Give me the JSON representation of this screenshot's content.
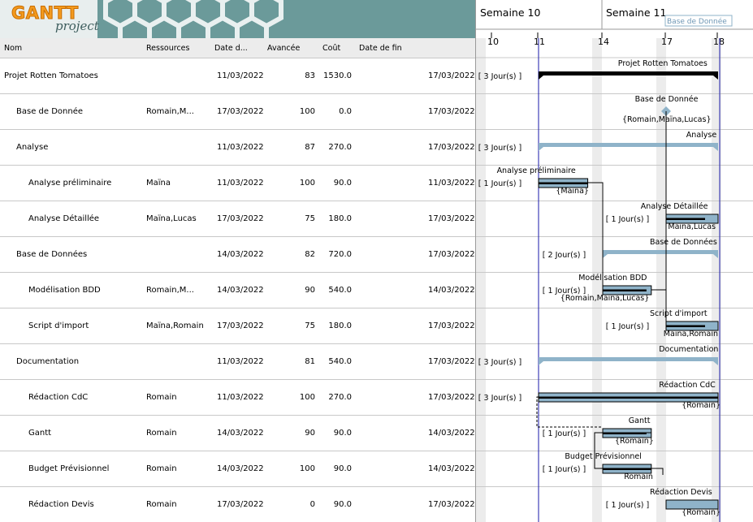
{
  "logo": {
    "gantt": "GANTT",
    "project": "project"
  },
  "columns": [
    "Nom",
    "Ressources",
    "Date d...",
    "Avancée",
    "Coût",
    "Date de fin"
  ],
  "tasks": [
    {
      "name": "Projet Rotten Tomatoes",
      "indent": 0,
      "resources": "",
      "start": "11/03/2022",
      "progress": "83",
      "cost": "1530.0",
      "end": "17/03/2022",
      "kind": "summary",
      "s": 11,
      "e": 18,
      "left_label": "[ 3 Jour(s) ]",
      "top_label": "Projet Rotten Tomatoes",
      "bottom_label": ""
    },
    {
      "name": "Base de Donnée",
      "indent": 1,
      "resources": "Romain,M...",
      "start": "17/03/2022",
      "progress": "100",
      "cost": "0.0",
      "end": "17/03/2022",
      "kind": "milestone",
      "s": 17,
      "e": 17,
      "left_label": "",
      "top_label": "Base de Donnée",
      "bottom_label": "{Romain,Maïna,Lucas}"
    },
    {
      "name": "Analyse",
      "indent": 1,
      "resources": "",
      "start": "11/03/2022",
      "progress": "87",
      "cost": "270.0",
      "end": "17/03/2022",
      "kind": "group",
      "s": 11,
      "e": 18,
      "left_label": "[ 3 Jour(s) ]",
      "top_label": "Analyse",
      "bottom_label": ""
    },
    {
      "name": "Analyse préliminaire",
      "indent": 2,
      "resources": "Maïna",
      "start": "11/03/2022",
      "progress": "100",
      "cost": "90.0",
      "end": "11/03/2022",
      "kind": "task",
      "s": 11,
      "e": 13.3,
      "pct": 1.0,
      "left_label": "[ 1 Jour(s) ]",
      "top_label": "Analyse préliminaire",
      "bottom_label": "{Maïna}"
    },
    {
      "name": "Analyse Détaillée",
      "indent": 2,
      "resources": "Maïna,Lucas",
      "start": "17/03/2022",
      "progress": "75",
      "cost": "180.0",
      "end": "17/03/2022",
      "kind": "task",
      "s": 17,
      "e": 18,
      "pct": 0.75,
      "left_label": "[ 1 Jour(s) ]",
      "top_label": "Analyse Détaillée",
      "bottom_label": "Maïna,Lucas"
    },
    {
      "name": "Base de Données",
      "indent": 1,
      "resources": "",
      "start": "14/03/2022",
      "progress": "82",
      "cost": "720.0",
      "end": "17/03/2022",
      "kind": "group",
      "s": 14,
      "e": 18,
      "left_label": "[ 2 Jour(s) ]",
      "top_label": "Base de Données",
      "bottom_label": ""
    },
    {
      "name": "Modélisation BDD",
      "indent": 2,
      "resources": "Romain,M...",
      "start": "14/03/2022",
      "progress": "90",
      "cost": "540.0",
      "end": "14/03/2022",
      "kind": "task",
      "s": 14,
      "e": 16.3,
      "pct": 0.9,
      "left_label": "[ 1 Jour(s) ]",
      "top_label": "Modélisation BDD",
      "bottom_label": "{Romain,Maïna,Lucas}"
    },
    {
      "name": "Script d'import",
      "indent": 2,
      "resources": "Maïna,Romain",
      "start": "17/03/2022",
      "progress": "75",
      "cost": "180.0",
      "end": "17/03/2022",
      "kind": "task",
      "s": 17,
      "e": 18,
      "pct": 0.75,
      "left_label": "[ 1 Jour(s) ]",
      "top_label": "Script d'import",
      "bottom_label": "Maïna,Romain"
    },
    {
      "name": "Documentation",
      "indent": 1,
      "resources": "",
      "start": "11/03/2022",
      "progress": "81",
      "cost": "540.0",
      "end": "17/03/2022",
      "kind": "group",
      "s": 11,
      "e": 18,
      "left_label": "[ 3 Jour(s) ]",
      "top_label": "Documentation",
      "bottom_label": ""
    },
    {
      "name": "Rédaction CdC",
      "indent": 2,
      "resources": "Romain",
      "start": "11/03/2022",
      "progress": "100",
      "cost": "270.0",
      "end": "17/03/2022",
      "kind": "task",
      "s": 11,
      "e": 18,
      "pct": 1.0,
      "left_label": "[ 3 Jour(s) ]",
      "top_label": "Rédaction CdC",
      "bottom_label": "{Romain}"
    },
    {
      "name": "Gantt",
      "indent": 2,
      "resources": "Romain",
      "start": "14/03/2022",
      "progress": "90",
      "cost": "90.0",
      "end": "14/03/2022",
      "kind": "task",
      "s": 14,
      "e": 16.3,
      "pct": 0.9,
      "left_label": "[ 1 Jour(s) ]",
      "top_label": "Gantt",
      "bottom_label": "{Romain}"
    },
    {
      "name": "Budget Prévisionnel",
      "indent": 2,
      "resources": "Romain",
      "start": "14/03/2022",
      "progress": "100",
      "cost": "90.0",
      "end": "14/03/2022",
      "kind": "task",
      "s": 14,
      "e": 16.3,
      "pct": 1.0,
      "left_label": "[ 1 Jour(s) ]",
      "top_label": "Budget Prévisionnel",
      "bottom_label": "Romain"
    },
    {
      "name": "Rédaction Devis",
      "indent": 2,
      "resources": "Romain",
      "start": "17/03/2022",
      "progress": "0",
      "cost": "90.0",
      "end": "17/03/2022",
      "kind": "task",
      "s": 17,
      "e": 18,
      "pct": 0.0,
      "left_label": "[ 1 Jour(s) ]",
      "top_label": "Rédaction Devis",
      "bottom_label": "{Romain}"
    }
  ],
  "timeline": {
    "weeks": [
      {
        "label": "Semaine 10",
        "at": 10
      },
      {
        "label": "Semaine 11",
        "at": 14
      }
    ],
    "days": [
      {
        "label": "10",
        "at": 10
      },
      {
        "label": "11",
        "at": 11
      },
      {
        "label": "14",
        "at": 14
      },
      {
        "label": "17",
        "at": 17
      },
      {
        "label": "18",
        "at": 18
      }
    ],
    "milestone_tag": "Base de Donnée",
    "colors": {
      "bar": "#8fb3c9",
      "bar_border": "#000000",
      "progress": "#000000",
      "summary": "#000000",
      "group": "#8fb3c9",
      "today": "#1a1aa8",
      "weekend": "#ececec"
    }
  }
}
